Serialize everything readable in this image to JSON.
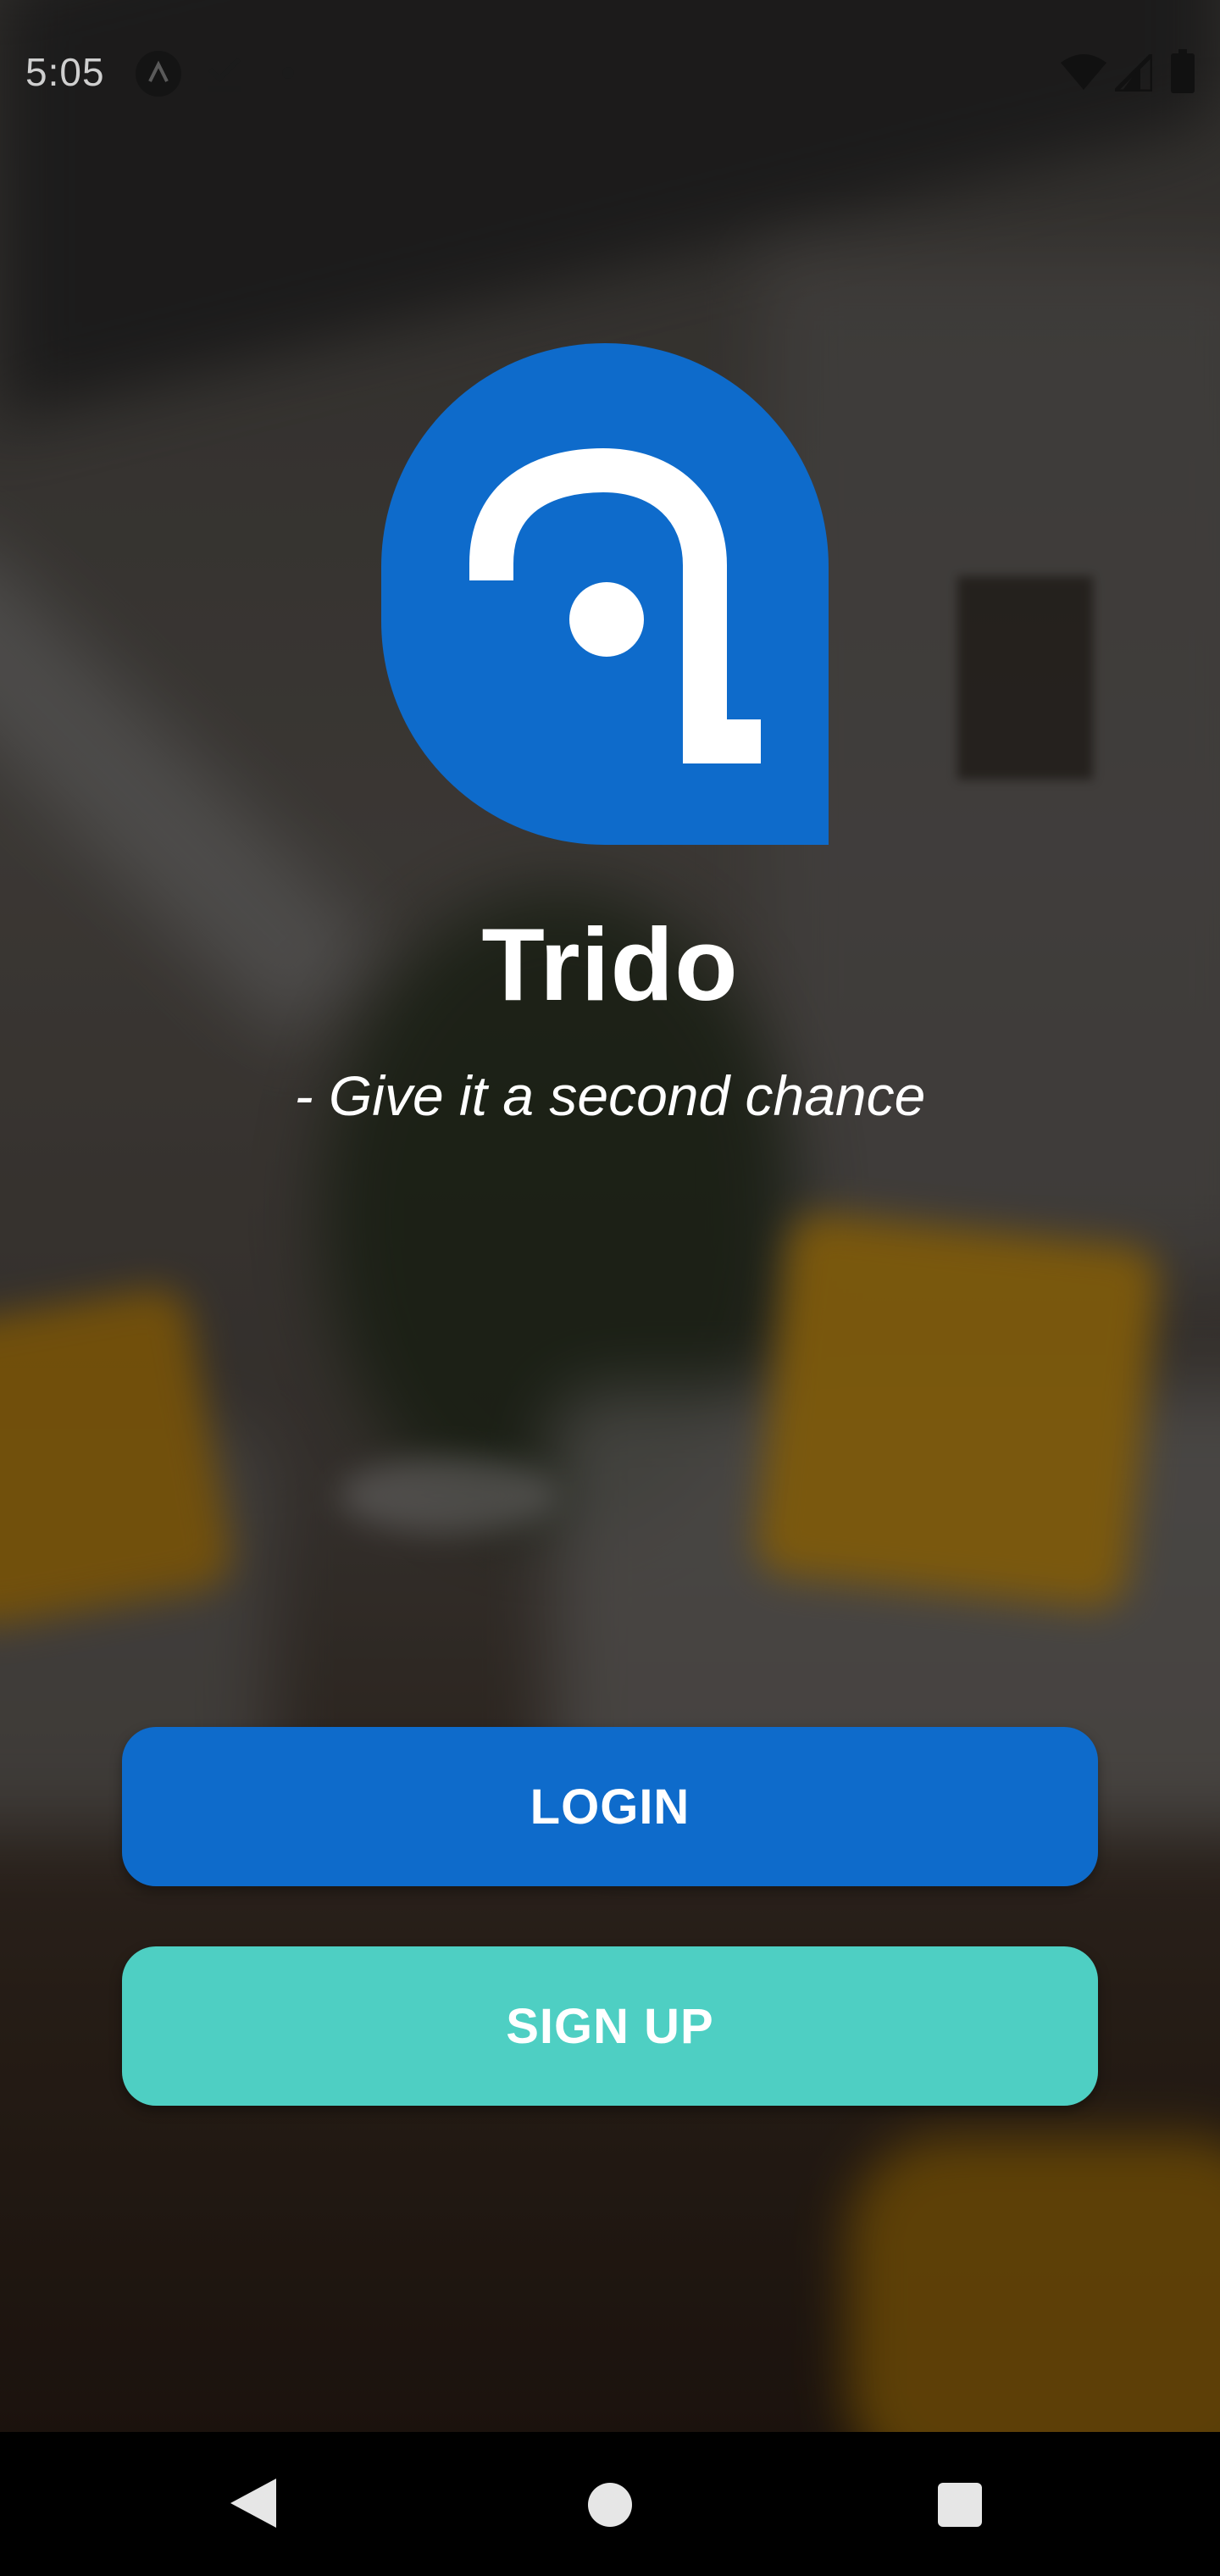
{
  "status_bar": {
    "time": "5:05",
    "icons": [
      "app-notification-icon",
      "download-done-icon",
      "dot-icon",
      "wifi-icon",
      "signal-icon",
      "battery-icon"
    ]
  },
  "app": {
    "name": "Trido",
    "tagline": "- Give it a second chance",
    "logo_icon": "trido-logo-icon"
  },
  "actions": {
    "login_label": "LOGIN",
    "signup_label": "SIGN UP"
  },
  "nav_bar": {
    "icons": [
      "back-icon",
      "home-icon",
      "recents-icon"
    ]
  },
  "colors": {
    "primary": "#0e6bcb",
    "secondary": "#4ecfc3",
    "text": "#ffffff",
    "nav_bar": "#000000"
  }
}
